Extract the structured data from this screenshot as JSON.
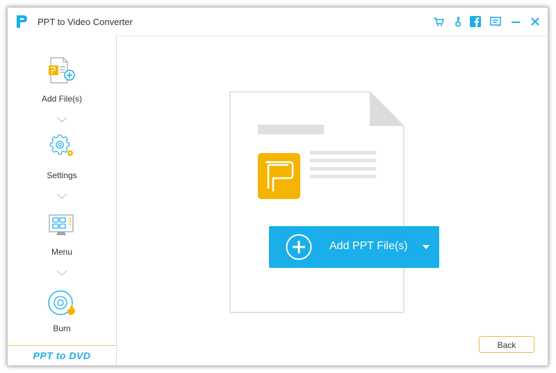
{
  "window": {
    "title": "PPT to Video Converter",
    "title_icons": [
      "cart-icon",
      "key-icon",
      "facebook-icon",
      "feedback-icon",
      "minimize-icon",
      "close-icon"
    ]
  },
  "sidebar": {
    "steps": [
      {
        "label": "Add File(s)",
        "icon": "add-file-icon"
      },
      {
        "label": "Settings",
        "icon": "settings-gear-icon"
      },
      {
        "label": "Menu",
        "icon": "menu-template-icon"
      },
      {
        "label": "Burn",
        "icon": "burn-disc-icon"
      }
    ],
    "brand": "PPT to DVD"
  },
  "main": {
    "add_button_label": "Add PPT File(s)",
    "back_label": "Back"
  },
  "colors": {
    "accent": "#1aaeea",
    "ppt_orange": "#f5b400",
    "back_border": "#e8b94a",
    "doc_gray": "#d9d9d9"
  }
}
